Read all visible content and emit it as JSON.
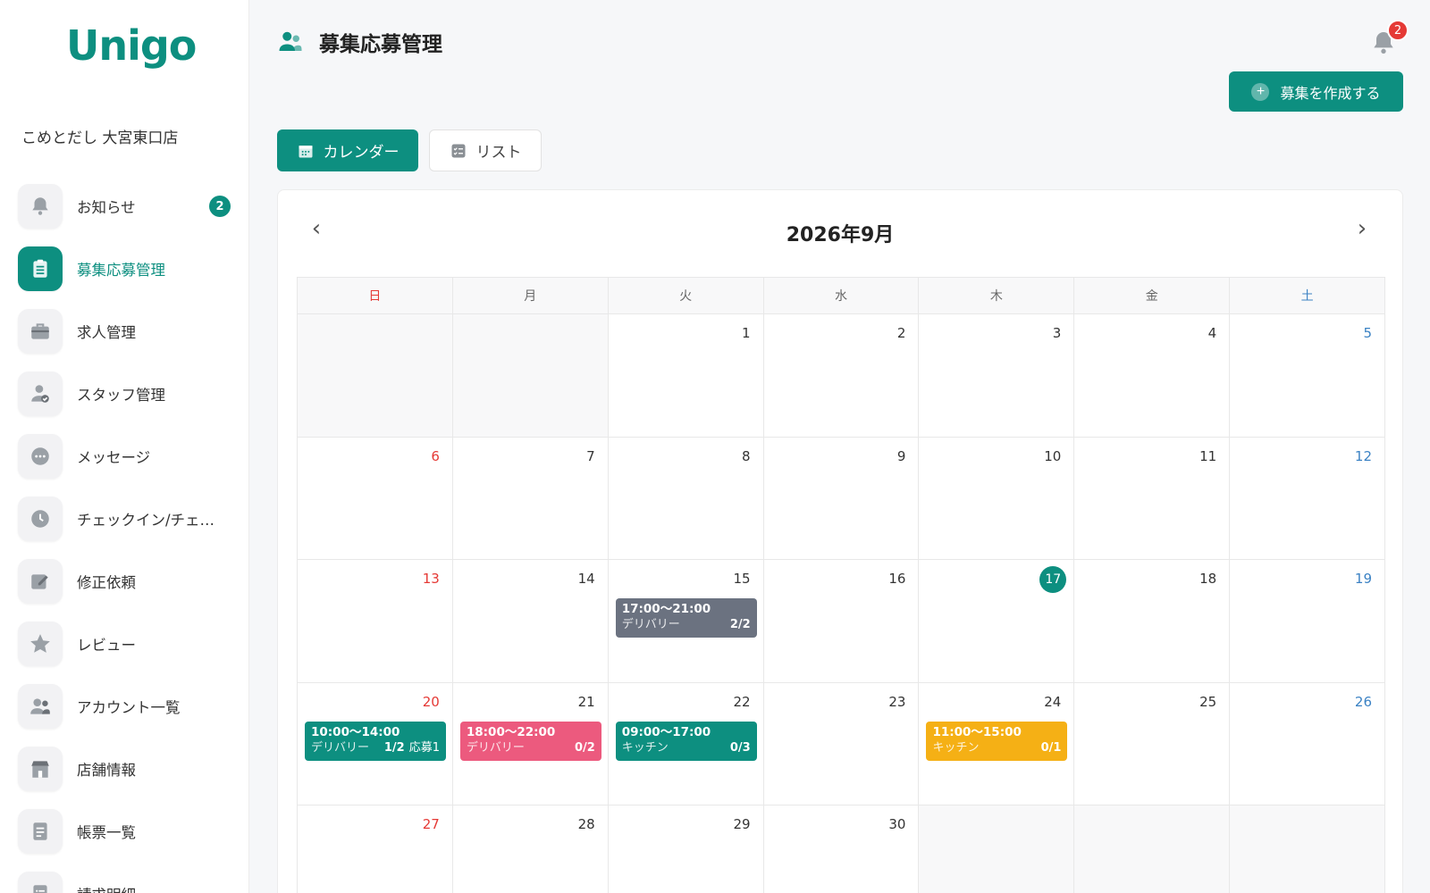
{
  "app": {
    "logo": "Unigo",
    "store_name": "こめとだし 大宮東口店"
  },
  "sidebar": {
    "items": [
      {
        "label": "お知らせ",
        "icon": "bell-icon",
        "badge": "2"
      },
      {
        "label": "募集応募管理",
        "icon": "clipboard-list-icon",
        "active": true
      },
      {
        "label": "求人管理",
        "icon": "briefcase-icon"
      },
      {
        "label": "スタッフ管理",
        "icon": "user-check-icon"
      },
      {
        "label": "メッセージ",
        "icon": "chat-bubble-icon"
      },
      {
        "label": "チェックイン/チェ…",
        "icon": "clock-icon"
      },
      {
        "label": "修正依頼",
        "icon": "edit-icon"
      },
      {
        "label": "レビュー",
        "icon": "star-icon"
      },
      {
        "label": "アカウント一覧",
        "icon": "users-icon"
      },
      {
        "label": "店舗情報",
        "icon": "store-icon"
      },
      {
        "label": "帳票一覧",
        "icon": "document-icon"
      },
      {
        "label": "請求明細",
        "icon": "invoice-list-icon"
      }
    ]
  },
  "header": {
    "title": "募集応募管理",
    "notification_count": "2"
  },
  "actions": {
    "create_label": "募集を作成する"
  },
  "tabs": {
    "calendar": "カレンダー",
    "list": "リスト"
  },
  "calendar": {
    "month_label": "2026年9月",
    "weekdays": [
      "日",
      "月",
      "火",
      "水",
      "木",
      "金",
      "土"
    ],
    "weeks": [
      [
        null,
        null,
        {
          "d": "1"
        },
        {
          "d": "2"
        },
        {
          "d": "3"
        },
        {
          "d": "4"
        },
        {
          "d": "5"
        }
      ],
      [
        {
          "d": "6"
        },
        {
          "d": "7"
        },
        {
          "d": "8"
        },
        {
          "d": "9"
        },
        {
          "d": "10"
        },
        {
          "d": "11"
        },
        {
          "d": "12"
        }
      ],
      [
        {
          "d": "13"
        },
        {
          "d": "14"
        },
        {
          "d": "15",
          "event": {
            "time": "17:00〜21:00",
            "role": "デリバリー",
            "count": "2/2",
            "color": "#6b7280"
          }
        },
        {
          "d": "16"
        },
        {
          "d": "17",
          "today": true
        },
        {
          "d": "18"
        },
        {
          "d": "19"
        }
      ],
      [
        {
          "d": "20",
          "event": {
            "time": "10:00〜14:00",
            "role": "デリバリー",
            "count": "1/2",
            "applicants": "応募1",
            "color": "#0d8f80"
          }
        },
        {
          "d": "21",
          "event": {
            "time": "18:00〜22:00",
            "role": "デリバリー",
            "count": "0/2",
            "color": "#ec5a7e"
          }
        },
        {
          "d": "22",
          "event": {
            "time": "09:00〜17:00",
            "role": "キッチン",
            "count": "0/3",
            "color": "#0d8f80"
          }
        },
        {
          "d": "23"
        },
        {
          "d": "24",
          "event": {
            "time": "11:00〜15:00",
            "role": "キッチン",
            "count": "0/1",
            "color": "#f5b015"
          }
        },
        {
          "d": "25"
        },
        {
          "d": "26"
        }
      ],
      [
        {
          "d": "27"
        },
        {
          "d": "28"
        },
        {
          "d": "29"
        },
        {
          "d": "30"
        },
        null,
        null,
        null
      ]
    ]
  },
  "colors": {
    "brand": "#0d8f80",
    "sunday": "#e53935",
    "saturday": "#3b82c4",
    "alert": "#e53935"
  }
}
